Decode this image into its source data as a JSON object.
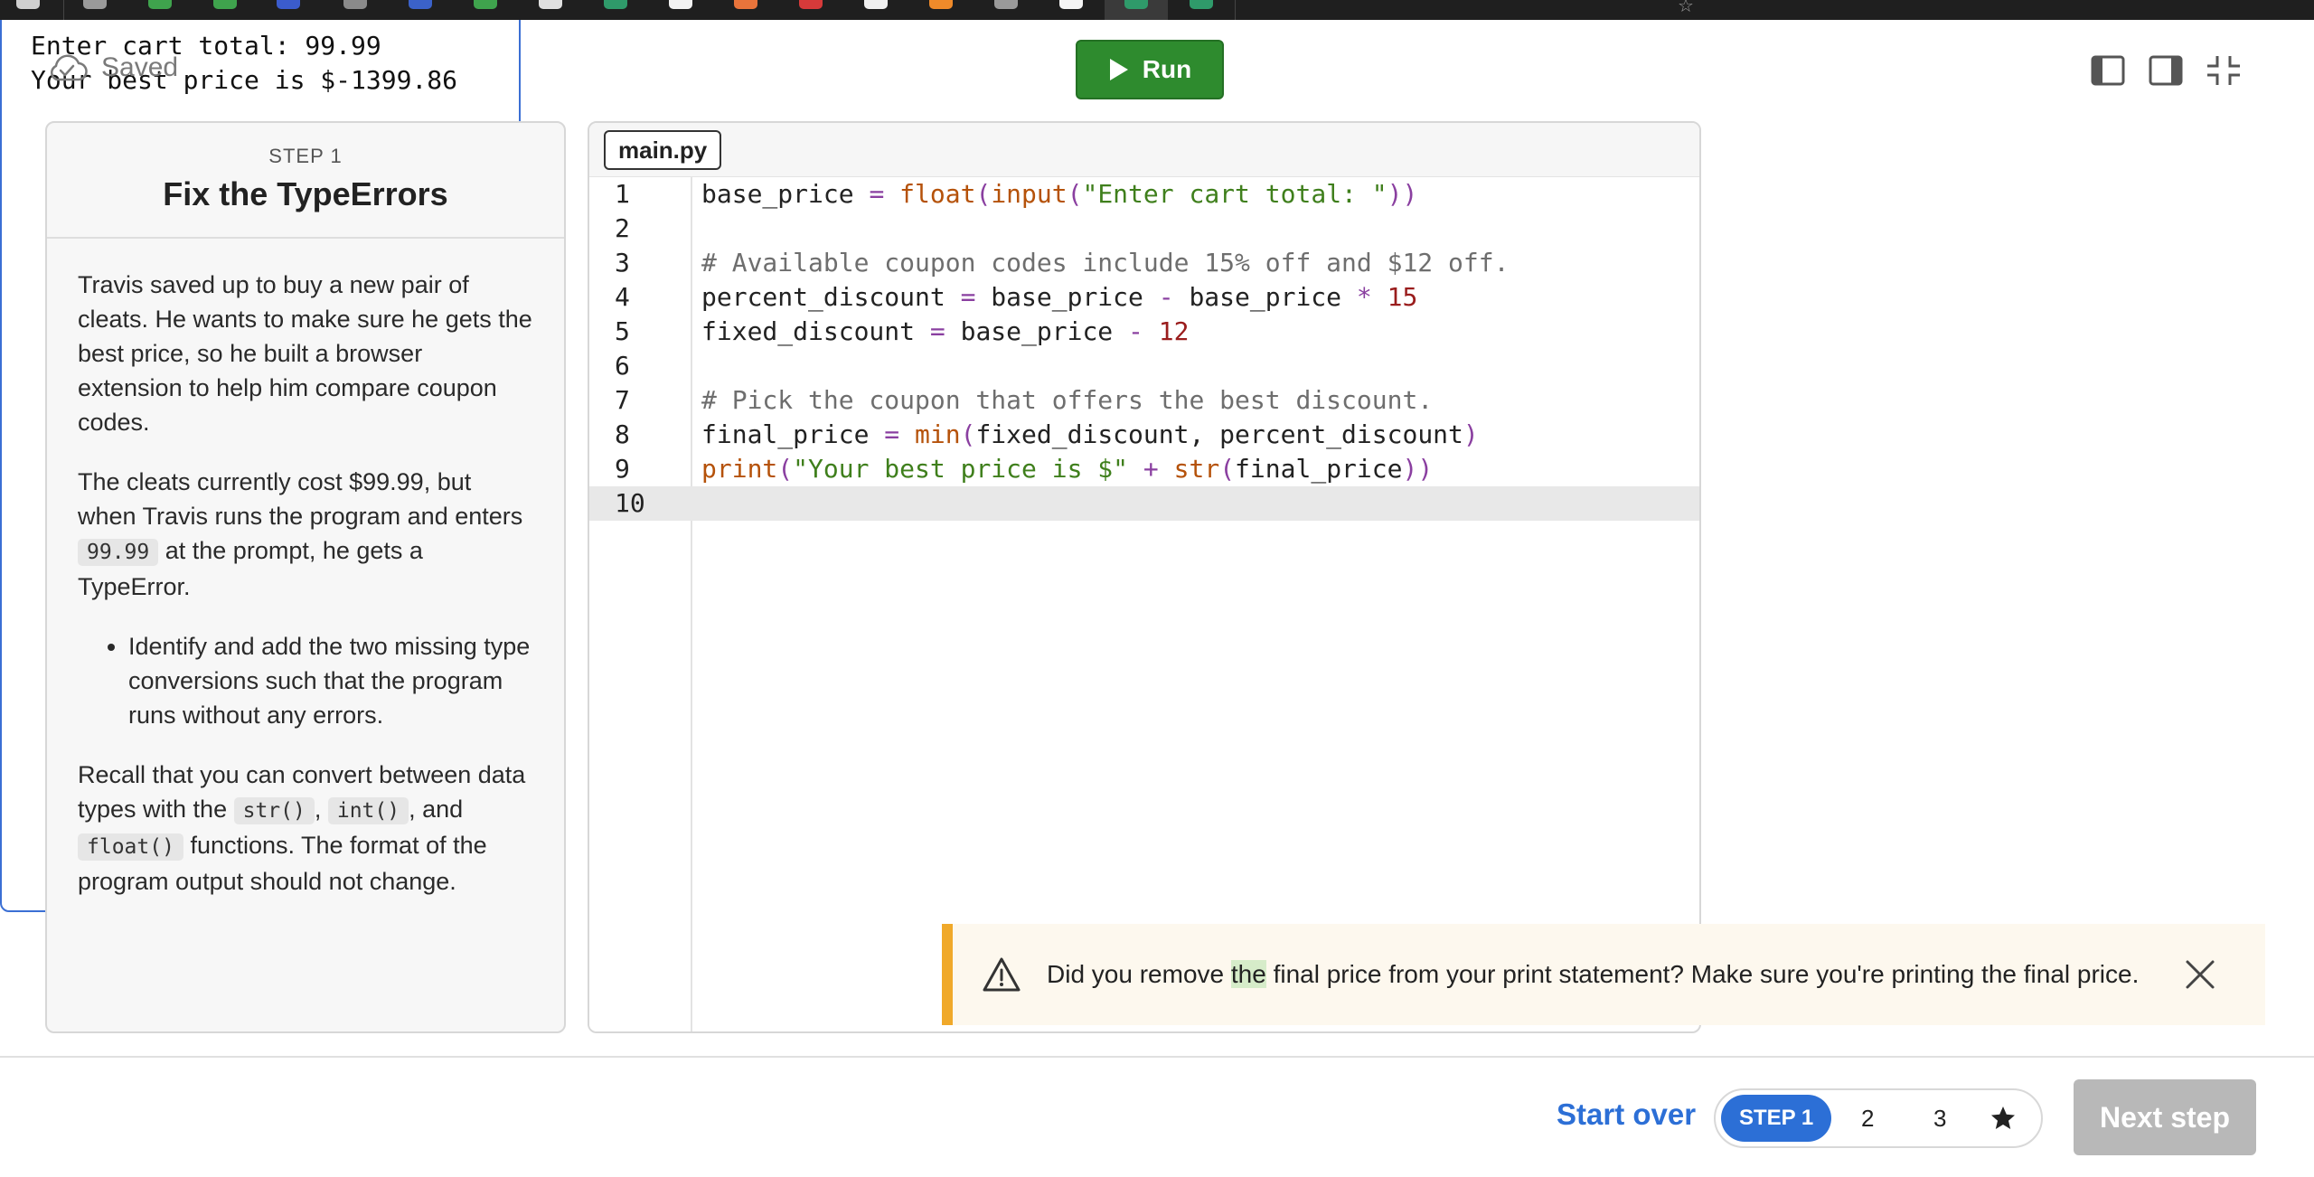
{
  "header": {
    "saved_label": "Saved",
    "run_label": "Run"
  },
  "instructions": {
    "step_label": "STEP 1",
    "title": "Fix the TypeErrors",
    "p1": "Travis saved up to buy a new pair of cleats. He wants to make sure he gets the best price, so he built a browser extension to help him compare coupon codes.",
    "p2_before": "The cleats currently cost $99.99, but when Travis runs the program and enters ",
    "p2_code": "99.99",
    "p2_after": " at the prompt, he gets a TypeError.",
    "bullet1": "Identify and add the two missing type conversions such that the program runs without any errors.",
    "p3_before": "Recall that you can convert between data types with the ",
    "p3_code1": "str()",
    "p3_sep1": ", ",
    "p3_code2": "int()",
    "p3_sep2": ", and ",
    "p3_code3": "float()",
    "p3_after": " functions. The format of the program output should not change."
  },
  "editor": {
    "filename": "main.py",
    "line_numbers": [
      "1",
      "2",
      "3",
      "4",
      "5",
      "6",
      "7",
      "8",
      "9",
      "10"
    ]
  },
  "console": {
    "output": "Enter cart total: 99.99\nYour best price is $-1399.86"
  },
  "toast": {
    "msg_before": "Did you remove ",
    "msg_highlight": "the",
    "msg_after": " final price from your print statement? Make sure you're printing the final price."
  },
  "footer": {
    "start_over": "Start over",
    "step1": "STEP 1",
    "step2": "2",
    "step3": "3",
    "next_step": "Next step"
  },
  "colors": {
    "run_green": "#2e8b2e",
    "accent_blue": "#2c6fd6",
    "warning_orange": "#f0a92a",
    "console_border": "#3b6fd4"
  }
}
